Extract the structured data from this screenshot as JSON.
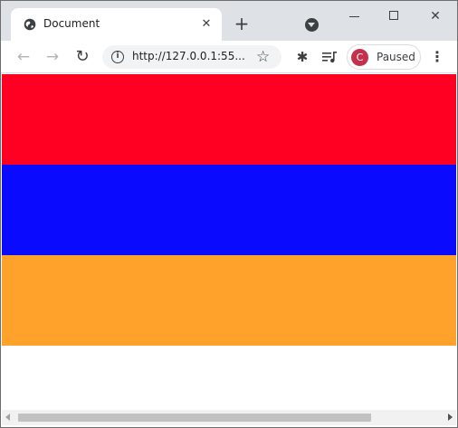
{
  "window": {
    "tab_title": "Document",
    "tab_close": "✕",
    "new_tab": "+",
    "controls": {
      "close": "✕"
    }
  },
  "toolbar": {
    "back_icon": "←",
    "forward_icon": "→",
    "reload_icon": "↻",
    "info_icon": "i",
    "url": "http://127.0.0.1:55...",
    "star_icon": "☆",
    "extensions_icon": "✱",
    "menu_icon": "⋮",
    "profile": {
      "initial": "C",
      "status": "Paused",
      "avatar_color": "#c4304b"
    }
  },
  "page": {
    "stripes": [
      {
        "name": "red",
        "color": "#ff0022"
      },
      {
        "name": "blue",
        "color": "#0a0aff"
      },
      {
        "name": "orange",
        "color": "#ffa22c"
      }
    ]
  },
  "colors": {
    "tabstrip_bg": "#dee1e6",
    "omnibox_bg": "#f1f3f4"
  }
}
